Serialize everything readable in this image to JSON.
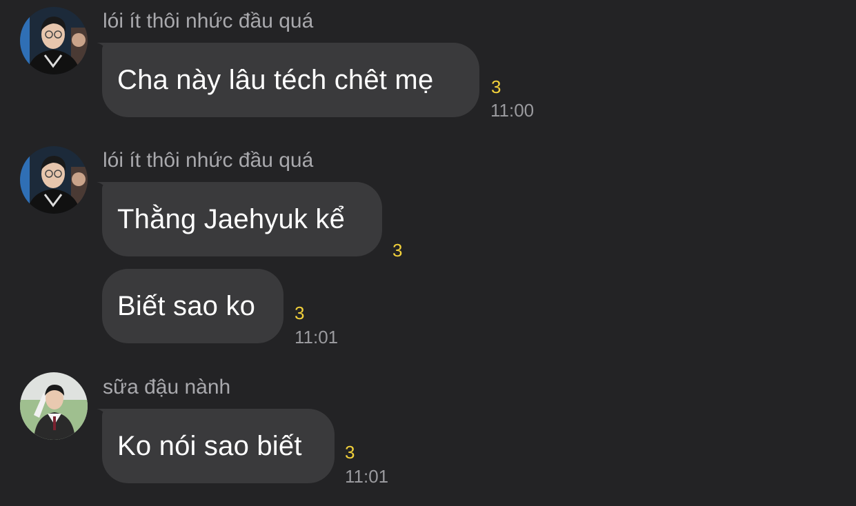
{
  "messages": [
    {
      "sender": "lói ít thôi nhức đầu quá",
      "text": "Cha này lâu téch chêt mẹ",
      "read_count": "3",
      "time": "11:00"
    },
    {
      "sender": "lói ít thôi nhức đầu quá",
      "text": "Thằng Jaehyuk kể",
      "read_count": "3"
    },
    {
      "text": "Biết sao ko",
      "read_count": "3",
      "time": "11:01"
    },
    {
      "sender": "sữa đậu nành",
      "text": "Ko nói sao biết",
      "read_count": "3",
      "time": "11:01"
    }
  ],
  "colors": {
    "background": "#232325",
    "bubble": "#3a3a3c",
    "sender_name": "#a9a9ad",
    "read_count": "#f2d13b",
    "timestamp": "#9a9a9e"
  },
  "icons": [
    "avatar-1",
    "avatar-2",
    "avatar-3"
  ]
}
